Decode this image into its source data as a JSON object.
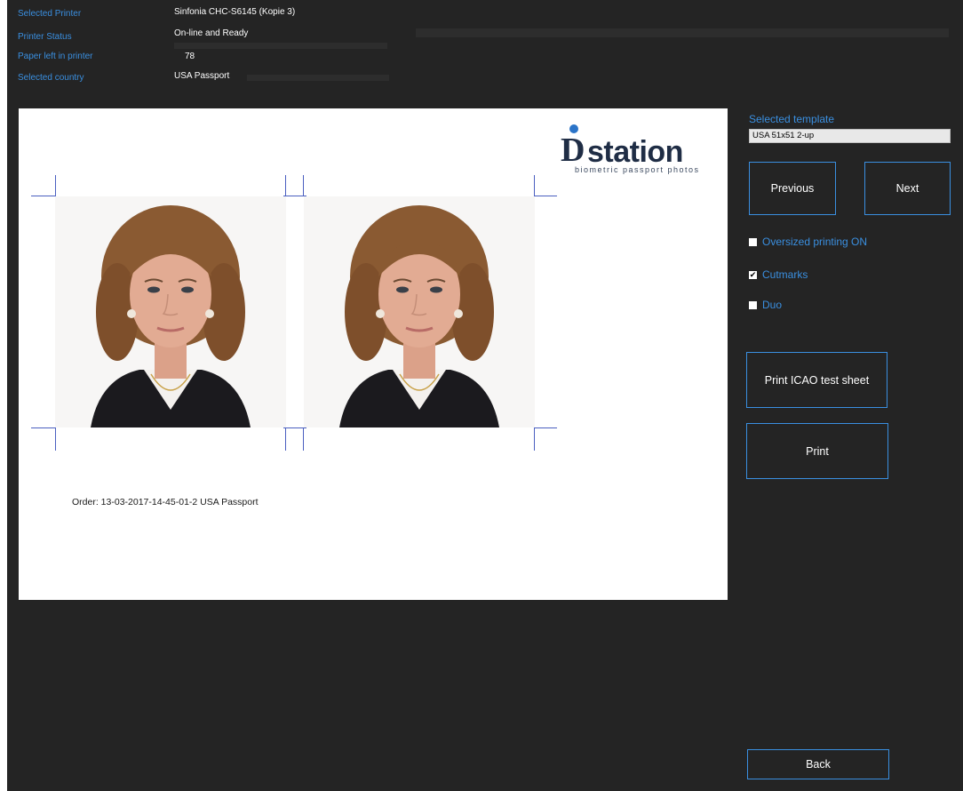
{
  "info": {
    "selected_printer_label": "Selected Printer",
    "selected_printer_value": "Sinfonia CHC-S6145 (Kopie 3)",
    "printer_status_label": "Printer Status",
    "printer_status_value": "On-line and Ready",
    "paper_left_label": "Paper left in printer",
    "paper_left_value": "78",
    "selected_country_label": "Selected country",
    "selected_country_value": "USA Passport"
  },
  "preview": {
    "logo_main": "station",
    "logo_sub": "biometric passport photos",
    "order_text": "Order: 13-03-2017-14-45-01-2 USA Passport",
    "photo_1": "portrait-photo-1",
    "photo_2": "portrait-photo-2"
  },
  "panel": {
    "template_label": "Selected template",
    "template_value": "USA 51x51 2-up",
    "previous_button": "Previous",
    "next_button": "Next",
    "oversized_label": "Oversized printing ON",
    "oversized_checked": false,
    "cutmarks_label": "Cutmarks",
    "cutmarks_checked": true,
    "duo_label": "Duo",
    "duo_checked": false,
    "icao_button": "Print ICAO test sheet",
    "print_button": "Print",
    "back_button": "Back"
  },
  "colors": {
    "background": "#242424",
    "accent": "#3a8fe0",
    "cutmark": "#4a5fc0",
    "text": "#ffffff"
  }
}
